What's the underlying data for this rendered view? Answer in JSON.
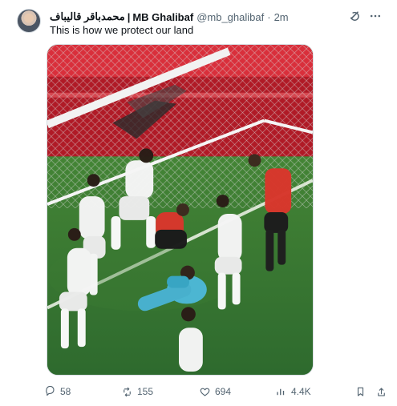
{
  "post": {
    "display_name_arabic": "محمدباقر قالیباف",
    "separator": "|",
    "display_name": "MB Ghalibaf",
    "handle": "@mb_ghalibaf",
    "dot": "·",
    "time": "2m",
    "text": "This is how we protect our land"
  },
  "actions": {
    "replies": "58",
    "reposts": "155",
    "likes": "694",
    "views": "4.4K"
  },
  "icons": {
    "top": [
      "grok-icon",
      "more-icon"
    ],
    "bottom": [
      "reply-icon",
      "repost-icon",
      "like-icon",
      "views-icon",
      "bookmark-icon",
      "share-icon"
    ]
  },
  "colors": {
    "text": "#0f1419",
    "muted": "#536471",
    "border": "#d7dde2"
  }
}
